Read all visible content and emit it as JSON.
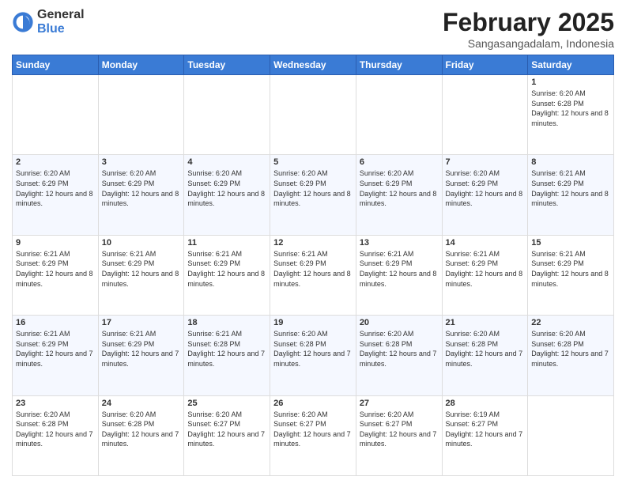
{
  "logo": {
    "general": "General",
    "blue": "Blue"
  },
  "header": {
    "month_year": "February 2025",
    "location": "Sangasangadalam, Indonesia"
  },
  "days_of_week": [
    "Sunday",
    "Monday",
    "Tuesday",
    "Wednesday",
    "Thursday",
    "Friday",
    "Saturday"
  ],
  "weeks": [
    [
      {
        "day": "",
        "info": ""
      },
      {
        "day": "",
        "info": ""
      },
      {
        "day": "",
        "info": ""
      },
      {
        "day": "",
        "info": ""
      },
      {
        "day": "",
        "info": ""
      },
      {
        "day": "",
        "info": ""
      },
      {
        "day": "1",
        "info": "Sunrise: 6:20 AM\nSunset: 6:28 PM\nDaylight: 12 hours and 8 minutes."
      }
    ],
    [
      {
        "day": "2",
        "info": "Sunrise: 6:20 AM\nSunset: 6:29 PM\nDaylight: 12 hours and 8 minutes."
      },
      {
        "day": "3",
        "info": "Sunrise: 6:20 AM\nSunset: 6:29 PM\nDaylight: 12 hours and 8 minutes."
      },
      {
        "day": "4",
        "info": "Sunrise: 6:20 AM\nSunset: 6:29 PM\nDaylight: 12 hours and 8 minutes."
      },
      {
        "day": "5",
        "info": "Sunrise: 6:20 AM\nSunset: 6:29 PM\nDaylight: 12 hours and 8 minutes."
      },
      {
        "day": "6",
        "info": "Sunrise: 6:20 AM\nSunset: 6:29 PM\nDaylight: 12 hours and 8 minutes."
      },
      {
        "day": "7",
        "info": "Sunrise: 6:20 AM\nSunset: 6:29 PM\nDaylight: 12 hours and 8 minutes."
      },
      {
        "day": "8",
        "info": "Sunrise: 6:21 AM\nSunset: 6:29 PM\nDaylight: 12 hours and 8 minutes."
      }
    ],
    [
      {
        "day": "9",
        "info": "Sunrise: 6:21 AM\nSunset: 6:29 PM\nDaylight: 12 hours and 8 minutes."
      },
      {
        "day": "10",
        "info": "Sunrise: 6:21 AM\nSunset: 6:29 PM\nDaylight: 12 hours and 8 minutes."
      },
      {
        "day": "11",
        "info": "Sunrise: 6:21 AM\nSunset: 6:29 PM\nDaylight: 12 hours and 8 minutes."
      },
      {
        "day": "12",
        "info": "Sunrise: 6:21 AM\nSunset: 6:29 PM\nDaylight: 12 hours and 8 minutes."
      },
      {
        "day": "13",
        "info": "Sunrise: 6:21 AM\nSunset: 6:29 PM\nDaylight: 12 hours and 8 minutes."
      },
      {
        "day": "14",
        "info": "Sunrise: 6:21 AM\nSunset: 6:29 PM\nDaylight: 12 hours and 8 minutes."
      },
      {
        "day": "15",
        "info": "Sunrise: 6:21 AM\nSunset: 6:29 PM\nDaylight: 12 hours and 8 minutes."
      }
    ],
    [
      {
        "day": "16",
        "info": "Sunrise: 6:21 AM\nSunset: 6:29 PM\nDaylight: 12 hours and 7 minutes."
      },
      {
        "day": "17",
        "info": "Sunrise: 6:21 AM\nSunset: 6:29 PM\nDaylight: 12 hours and 7 minutes."
      },
      {
        "day": "18",
        "info": "Sunrise: 6:21 AM\nSunset: 6:28 PM\nDaylight: 12 hours and 7 minutes."
      },
      {
        "day": "19",
        "info": "Sunrise: 6:20 AM\nSunset: 6:28 PM\nDaylight: 12 hours and 7 minutes."
      },
      {
        "day": "20",
        "info": "Sunrise: 6:20 AM\nSunset: 6:28 PM\nDaylight: 12 hours and 7 minutes."
      },
      {
        "day": "21",
        "info": "Sunrise: 6:20 AM\nSunset: 6:28 PM\nDaylight: 12 hours and 7 minutes."
      },
      {
        "day": "22",
        "info": "Sunrise: 6:20 AM\nSunset: 6:28 PM\nDaylight: 12 hours and 7 minutes."
      }
    ],
    [
      {
        "day": "23",
        "info": "Sunrise: 6:20 AM\nSunset: 6:28 PM\nDaylight: 12 hours and 7 minutes."
      },
      {
        "day": "24",
        "info": "Sunrise: 6:20 AM\nSunset: 6:28 PM\nDaylight: 12 hours and 7 minutes."
      },
      {
        "day": "25",
        "info": "Sunrise: 6:20 AM\nSunset: 6:27 PM\nDaylight: 12 hours and 7 minutes."
      },
      {
        "day": "26",
        "info": "Sunrise: 6:20 AM\nSunset: 6:27 PM\nDaylight: 12 hours and 7 minutes."
      },
      {
        "day": "27",
        "info": "Sunrise: 6:20 AM\nSunset: 6:27 PM\nDaylight: 12 hours and 7 minutes."
      },
      {
        "day": "28",
        "info": "Sunrise: 6:19 AM\nSunset: 6:27 PM\nDaylight: 12 hours and 7 minutes."
      },
      {
        "day": "",
        "info": ""
      }
    ]
  ]
}
